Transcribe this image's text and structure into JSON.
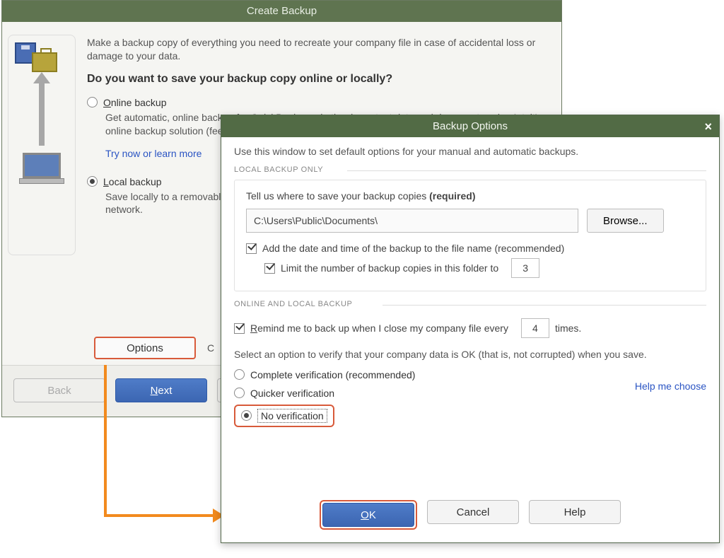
{
  "wizard": {
    "title": "Create Backup",
    "intro": "Make a backup copy of everything you need to recreate your company file in case of accidental loss or damage to your data.",
    "question": "Do you want to save your backup copy online or locally?",
    "online": {
      "label_pre": "O",
      "label_rest": "nline backup",
      "desc": "Get automatic, online backup for QuickBooks and other important data and documents using Intuit's online backup solution (fees may apply).",
      "link": "Try now or learn more"
    },
    "local": {
      "label_pre": "L",
      "label_rest": "ocal backup",
      "desc": "Save locally to a removable storage device (such as a CD or USB flash drive) or to a folder on your network."
    },
    "options_btn": "Options",
    "options_side": "C",
    "buttons": {
      "back": "Back",
      "back_key": "k",
      "next_pre": "N",
      "next_rest": "ext"
    }
  },
  "dialog": {
    "title": "Backup Options",
    "intro": "Use this window to set default options for your manual and automatic backups.",
    "section1": "LOCAL BACKUP ONLY",
    "where_prompt_a": "Tell us where to save your backup copies ",
    "where_prompt_b": "(required)",
    "path": "C:\\Users\\Public\\Documents\\",
    "browse": "Browse...",
    "add_date": "Add the date and time of the backup to the file name (recommended)",
    "limit_label": "Limit the number of backup copies in this folder to",
    "limit_value": "3",
    "section2": "ONLINE AND LOCAL BACKUP",
    "remind_pre": "R",
    "remind_rest": "emind me to back up when I close my company file every",
    "remind_value": "4",
    "remind_tail": "times.",
    "verify_text": "Select an option to verify that your company data is OK (that is, not corrupted) when you save.",
    "verify_opts": {
      "complete": "Complete verification (recommended)",
      "quicker": "Quicker verification",
      "none_pre": "N",
      "none_rest": "o verification"
    },
    "help_choose": "Help me choose",
    "buttons": {
      "ok_pre": "O",
      "ok_rest": "K",
      "cancel": "Cancel",
      "help": "Help"
    }
  }
}
